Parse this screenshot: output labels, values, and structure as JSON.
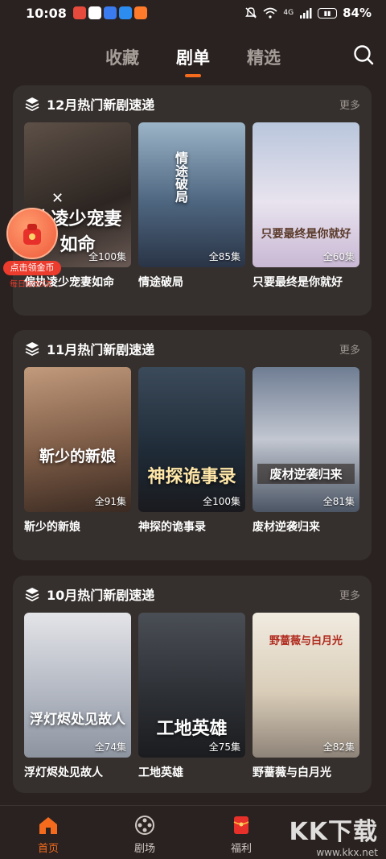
{
  "status_bar": {
    "time": "10:08",
    "network": "4G",
    "battery": "84%"
  },
  "top_tabs": [
    {
      "label": "收藏",
      "active": false
    },
    {
      "label": "剧单",
      "active": true
    },
    {
      "label": "精选",
      "active": false
    }
  ],
  "sections": [
    {
      "title": "12月热门新剧速递",
      "more": "更多",
      "items": [
        {
          "title": "偏执凌少宠妻如命",
          "episodes": "全100集",
          "art": "执凌少宠妻如命"
        },
        {
          "title": "情途破局",
          "episodes": "全85集",
          "art": "情途破局"
        },
        {
          "title": "只要最终是你就好",
          "episodes": "全60集",
          "art": "只要最终是你就好"
        }
      ]
    },
    {
      "title": "11月热门新剧速递",
      "more": "更多",
      "items": [
        {
          "title": "靳少的新娘",
          "episodes": "全91集",
          "art": "靳少的新娘"
        },
        {
          "title": "神探的诡事录",
          "episodes": "全100集",
          "art": "神探诡事录"
        },
        {
          "title": "废材逆袭归来",
          "episodes": "全81集",
          "art": "废材逆袭归来"
        }
      ]
    },
    {
      "title": "10月热门新剧速递",
      "more": "更多",
      "items": [
        {
          "title": "浮灯烬处见故人",
          "episodes": "全74集",
          "art": "浮灯烬处见故人"
        },
        {
          "title": "工地英雄",
          "episodes": "全75集",
          "art": "工地英雄"
        },
        {
          "title": "野蔷薇与白月光",
          "episodes": "全82集",
          "art": "野蔷薇与白月光"
        }
      ]
    }
  ],
  "coin_widget": {
    "label": "点击领金币",
    "sub": "每日0/20次"
  },
  "bottom_nav": [
    {
      "label": "首页",
      "icon": "home-icon",
      "active": true
    },
    {
      "label": "剧场",
      "icon": "film-reel-icon",
      "active": false
    },
    {
      "label": "福利",
      "icon": "red-envelope-icon",
      "active": false
    }
  ],
  "watermark": {
    "main": "KK下载",
    "url": "www.kkx.net"
  },
  "colors": {
    "accent": "#f46b1d",
    "background": "#2a2220",
    "card": "#35302d"
  }
}
